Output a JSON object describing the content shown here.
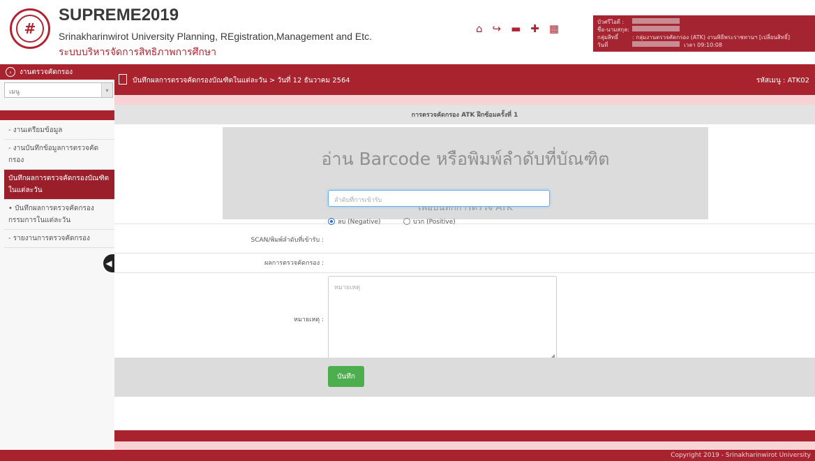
{
  "header": {
    "title": "SUPREME2019",
    "subtitle": "Srinakharinwirot University Planning, REgistration,Management and Etc.",
    "subtitle_th": "ระบบบริหารจัดการสิทธิภาพการศึกษา",
    "icons": [
      "home-icon",
      "logout-icon",
      "thai-flag-icon",
      "uk-flag-icon",
      "calendar-icon"
    ],
    "user": {
      "label1": "บัวศรีไอดี :",
      "label2": "ชื่อ-นามสกุล:",
      "label3": "กลุ่มสิทธิ์",
      "value3": ": กลุ่มงานตรวจคัดกรอง (ATK) งานพิธีพระราชทานฯ [เปลี่ยนสิทธิ์]",
      "label4": "วันที่",
      "value4": "เวลา 09:10:08"
    }
  },
  "sidebar": {
    "top_label": "งานตรวจคัดกรอง",
    "select_value": "เมนู",
    "items": [
      {
        "label": "งานเตรียมข้อมูล"
      },
      {
        "label": "งานบันทึกข้อมูลการตรวจคัดกรอง"
      },
      {
        "label": "บันทึกผลการตรวจคัดกรองบัณฑิตในแต่ละวัน"
      },
      {
        "label": "บันทึกผลการตรวจคัดกรองกรรมการในแต่ละวัน"
      },
      {
        "label": "รายงานการตรวจคัดกรอง"
      }
    ]
  },
  "breadcrumb": {
    "text": "บันทึกผลการตรวจคัดกรองบัณฑิตในแต่ละวัน > วันที่ 12 ธันวาคม 2564",
    "code": "รหัสเมนู : ATK02"
  },
  "form": {
    "title": "การตรวจคัดกรอง ATK ฝึกซ้อมครั้งที่ 1",
    "barcode_big": "อ่าน Barcode หรือพิมพ์ลำดับที่บัณฑิต",
    "barcode_small": "เพื่อบันทึกการตรวจ ATK",
    "scan_label": "SCAN/พิมพ์ลำดับที่เข้ารับ :",
    "scan_placeholder": "ลำดับที่การเข้ารับ",
    "result_label": "ผลการตรวจคัดกรอง :",
    "radio_negative": "ลบ (Negative)",
    "radio_positive": "บวก (Positive)",
    "note_label": "หมายเหตุ :",
    "note_placeholder": "หมายเหตุ",
    "save_label": "บันทึก"
  },
  "footer": {
    "copyright": "Copyright 2019 - Srinakharinwirot University"
  },
  "colors": {
    "brand": "#a8232e",
    "save": "#4cae4c"
  }
}
